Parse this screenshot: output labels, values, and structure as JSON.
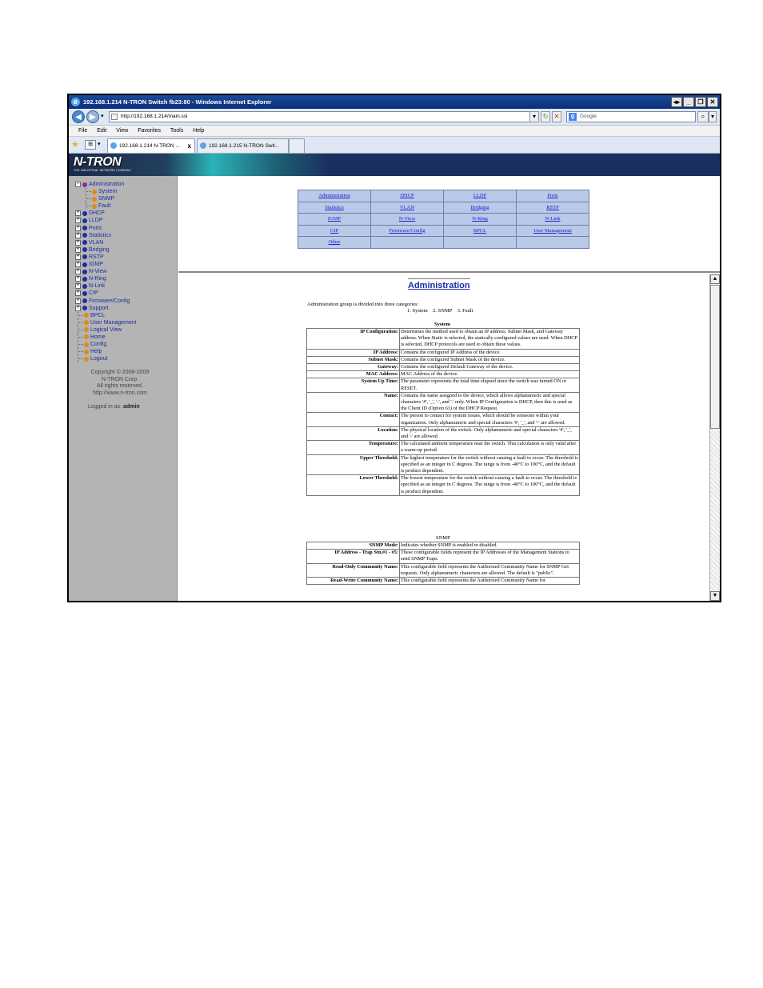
{
  "window": {
    "title": "192.168.1.214 N-TRON Switch fb23:80 - Windows Internet Explorer",
    "address": "http://192.168.1.214/main.ssi",
    "search_placeholder": "Google",
    "menu": [
      "File",
      "Edit",
      "View",
      "Favorites",
      "Tools",
      "Help"
    ],
    "tabs": [
      {
        "label": "192.168.1.214 N-TRON ..."
      },
      {
        "label": "192.168.1.215 N-TRON Swit..."
      }
    ]
  },
  "brand": {
    "logo": "N-TRON",
    "tagline": "THE INDUSTRIAL NETWORK COMPANY"
  },
  "sidebar": {
    "items": [
      {
        "label": "Administration",
        "expanded": true,
        "color": "#8e2a9c"
      },
      {
        "label": "System",
        "child": true
      },
      {
        "label": "SNMP",
        "child": true
      },
      {
        "label": "Fault",
        "child": true
      },
      {
        "label": "DHCP"
      },
      {
        "label": "LLDP"
      },
      {
        "label": "Ports"
      },
      {
        "label": "Statistics"
      },
      {
        "label": "VLAN"
      },
      {
        "label": "Bridging"
      },
      {
        "label": "RSTP"
      },
      {
        "label": "IGMP"
      },
      {
        "label": "N-View"
      },
      {
        "label": "N-Ring"
      },
      {
        "label": "N-Link"
      },
      {
        "label": "CIP"
      },
      {
        "label": "Firmware/Config"
      },
      {
        "label": "Support"
      },
      {
        "label": "BPCL",
        "leaf": true
      },
      {
        "label": "User Management",
        "leaf": true
      },
      {
        "label": "Logical View",
        "leaf": true
      },
      {
        "label": "Home",
        "leaf": true
      },
      {
        "label": "Config",
        "leaf": true
      },
      {
        "label": "Help",
        "leaf": true
      },
      {
        "label": "Logout",
        "leaf": true
      }
    ],
    "copyright": [
      "Copyright © 2008-2009",
      "N-TRON Corp.",
      "All rights reserved.",
      "http://www.n-tron.com"
    ],
    "logged_in_label": "Logged in as:",
    "logged_in_user": "admin"
  },
  "nav_grid": [
    [
      "Administration",
      "DHCP",
      "LLDP",
      "Ports"
    ],
    [
      "Statistics",
      "VLAN",
      "Bridging",
      "RSTP"
    ],
    [
      "IGMP",
      "N-View",
      "N-Ring",
      "N-Link"
    ],
    [
      "CIP",
      "Firmware/Config",
      "BPCL",
      "User Management"
    ],
    [
      "Other",
      "",
      "",
      ""
    ]
  ],
  "doc": {
    "title": "Administration",
    "intro": "Administration group is divided into three categories:",
    "categories": "1. System    2. SNMP    3. Fault",
    "system_heading": "System",
    "system_rows": [
      {
        "k": "IP Configuration:",
        "v": "Determines the method used to obtain an IP address, Subnet Mask, and Gateway address. When Static is selected, the statically configured values are used. When DHCP is selected, DHCP protocols are used to obtain these values."
      },
      {
        "k": "IP Address:",
        "v": "Contains the configured IP Address of the device."
      },
      {
        "k": "Subnet Mask:",
        "v": "Contains the configured Subnet Mask of the device."
      },
      {
        "k": "Gateway:",
        "v": "Contains the configured Default Gateway of the device."
      },
      {
        "k": "MAC Address:",
        "v": "MAC Address of the device."
      },
      {
        "k": "System Up Time:",
        "v": "The parameter represents the total time elapsed since the switch was turned ON or RESET."
      },
      {
        "k": "Name:",
        "v": "Contains the name assigned to the device, which allows alphanumeric and special characters '#', '_', '-', and '.' only. When IP Configuration is DHCP, then this is used as the Client ID (Option 61) of the DHCP Request."
      },
      {
        "k": "Contact:",
        "v": "The person to contact for system issues, which should be someone within your organization. Only alphanumeric and special characters '#', '_', and '-' are allowed."
      },
      {
        "k": "Location:",
        "v": "The physical location of the switch. Only alphanumeric and special characters '#', '_', and '-' are allowed."
      },
      {
        "k": "Temperature:",
        "v": "The calculated ambient temperature near the switch. This calculation is only valid after a warm-up period."
      },
      {
        "k": "Upper Threshold:",
        "v": "The highest temperature for the switch without causing a fault to occur. The threshold is specified as an integer in C degrees. The range is from -40°C to 100°C, and the default is product dependent."
      },
      {
        "k": "Lower Threshold:",
        "v": "The lowest temperature for the switch without causing a fault to occur. The threshold is specified as an integer in C degrees. The range is from -40°C to 100°C, and the default is product dependent."
      }
    ],
    "snmp_heading": "SNMP",
    "snmp_rows": [
      {
        "k": "SNMP Mode:",
        "v": "Indicates whether SNMP is enabled or disabled."
      },
      {
        "k": "IP Address - Trap Stn.#1 - #5:",
        "v": "These configurable fields represent the IP Addresses of the Management Stations to send SNMP Traps."
      },
      {
        "k": "Read-Only Community Name:",
        "v": "This configurable field represents the Authorized Community Name for SNMP Get requests. Only alphanumeric characters are allowed. The default is \"public\"."
      },
      {
        "k": "Read-Write Community Name:",
        "v": "This configurable field represents the Authorized Community Name for"
      }
    ]
  }
}
